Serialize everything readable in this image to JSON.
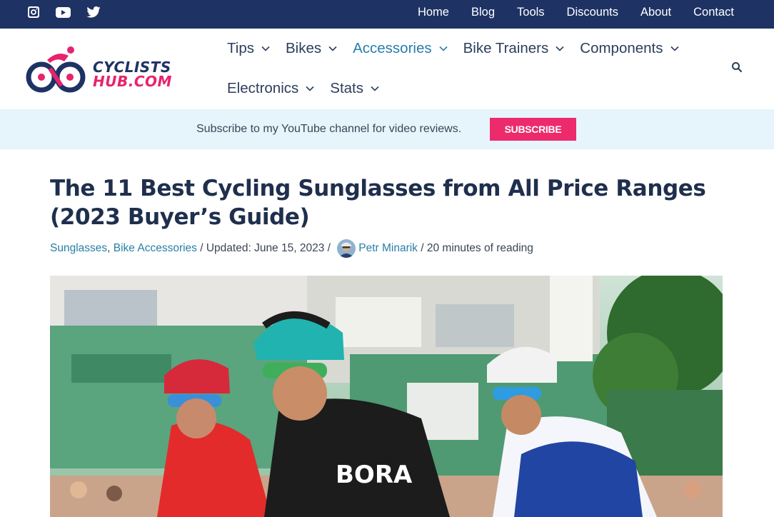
{
  "topbar": {
    "social_icons": [
      "instagram-icon",
      "youtube-icon",
      "twitter-icon"
    ],
    "links": [
      "Home",
      "Blog",
      "Tools",
      "Discounts",
      "About",
      "Contact"
    ]
  },
  "logo": {
    "line1": "CYCLISTS",
    "line2": "HUB.COM"
  },
  "mainnav": {
    "row1": [
      "Tips",
      "Bikes",
      "Accessories",
      "Bike Trainers",
      "Components"
    ],
    "row2": [
      "Electronics",
      "Stats"
    ],
    "active": "Accessories"
  },
  "subscribe": {
    "message": "Subscribe to my YouTube channel for video reviews.",
    "button": "SUBSCRIBE"
  },
  "article": {
    "title_line1": "The 11 Best Cycling Sunglasses from All Price Ranges",
    "title_line2": "(2023 Buyer’s Guide)",
    "category1": "Sunglasses",
    "separator1": ", ",
    "category2": "Bike Accessories",
    "updated": " / Updated: June 15, 2023 / ",
    "author": "Petr Minarik",
    "reading": " / 20 minutes of reading"
  },
  "colors": {
    "topbar": "#1e3264",
    "accent_pink": "#ec2a6c",
    "link_blue": "#2a7ea8",
    "subbar_bg": "#e6f4fb"
  }
}
